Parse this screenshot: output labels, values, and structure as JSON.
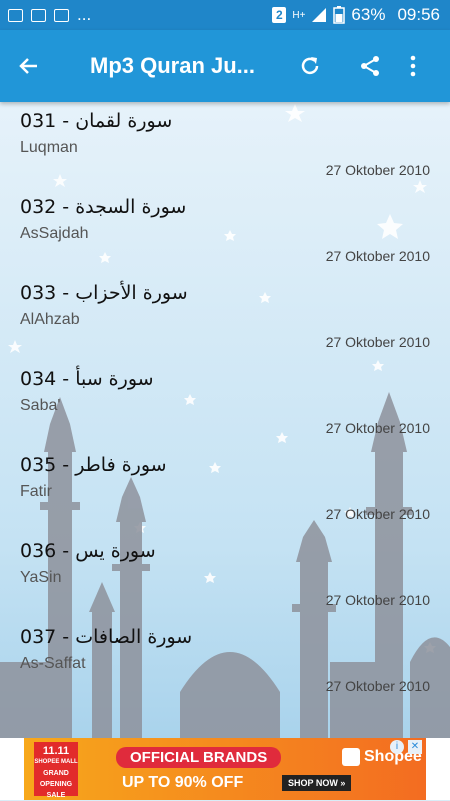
{
  "status_bar": {
    "more": "...",
    "sim": "2",
    "net": "H+",
    "battery": "63%",
    "time": "09:56"
  },
  "toolbar": {
    "title": "Mp3 Quran Ju...",
    "back_icon": "arrow-left-icon",
    "refresh_icon": "refresh-icon",
    "share_icon": "share-icon",
    "menu_icon": "more-vert-icon"
  },
  "tracks": [
    {
      "title": "031 - سورة لقمان",
      "name": "Luqman",
      "date": "27 Oktober 2010"
    },
    {
      "title": "032 - سورة السجدة",
      "name": "AsSajdah",
      "date": "27 Oktober 2010"
    },
    {
      "title": "033 - سورة الأحزاب",
      "name": "AlAhzab",
      "date": "27 Oktober 2010"
    },
    {
      "title": "034 - سورة سبأ",
      "name": "Saba'",
      "date": "27 Oktober 2010"
    },
    {
      "title": "035 - سورة فاطر",
      "name": "Fatir",
      "date": "27 Oktober 2010"
    },
    {
      "title": "036 - سورة يس",
      "name": "YaSin",
      "date": "27 Oktober 2010"
    },
    {
      "title": "037 - سورة الصافات",
      "name": "As-Saffat",
      "date": "27 Oktober 2010"
    }
  ],
  "ad": {
    "logo_line1": "11.11",
    "logo_line2": "SHOPEE MALL",
    "logo_line3": "GRAND OPENING SALE",
    "headline": "OFFICIAL BRANDS",
    "subline": "UP TO 90% OFF",
    "cta": "SHOP NOW »",
    "brand": "Shopee"
  },
  "colors": {
    "status_bar": "#1f86c9",
    "app_bar": "#2196d8",
    "ad_orange": "#f7a81b"
  }
}
